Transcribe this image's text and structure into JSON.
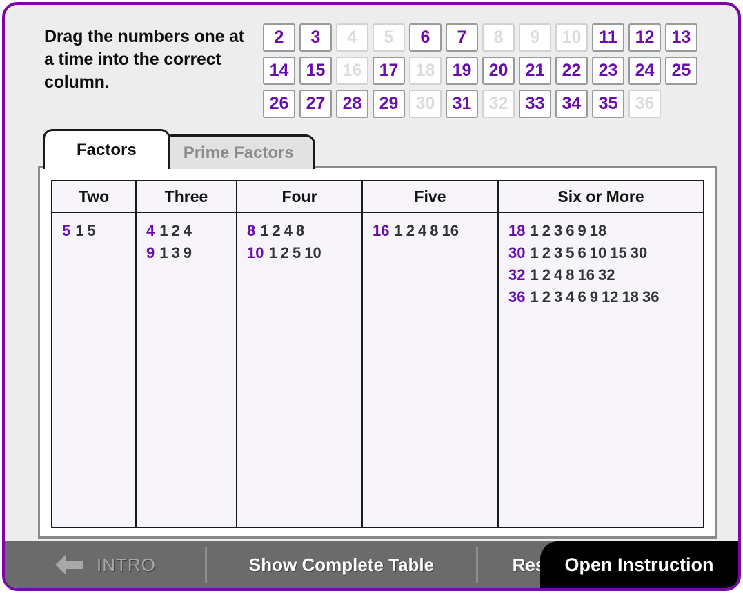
{
  "instruction": "Drag the numbers one at a time into the correct column.",
  "number_tray": {
    "rows": [
      [
        {
          "n": "2",
          "placed": false
        },
        {
          "n": "3",
          "placed": false
        },
        {
          "n": "4",
          "placed": true
        },
        {
          "n": "5",
          "placed": true
        },
        {
          "n": "6",
          "placed": false
        },
        {
          "n": "7",
          "placed": false
        },
        {
          "n": "8",
          "placed": true
        },
        {
          "n": "9",
          "placed": true
        },
        {
          "n": "10",
          "placed": true
        },
        {
          "n": "11",
          "placed": false
        },
        {
          "n": "12",
          "placed": false
        },
        {
          "n": "13",
          "placed": false
        }
      ],
      [
        {
          "n": "14",
          "placed": false
        },
        {
          "n": "15",
          "placed": false
        },
        {
          "n": "16",
          "placed": true
        },
        {
          "n": "17",
          "placed": false
        },
        {
          "n": "18",
          "placed": true
        },
        {
          "n": "19",
          "placed": false
        },
        {
          "n": "20",
          "placed": false
        },
        {
          "n": "21",
          "placed": false
        },
        {
          "n": "22",
          "placed": false
        },
        {
          "n": "23",
          "placed": false
        },
        {
          "n": "24",
          "placed": false
        },
        {
          "n": "25",
          "placed": false
        }
      ],
      [
        {
          "n": "26",
          "placed": false
        },
        {
          "n": "27",
          "placed": false
        },
        {
          "n": "28",
          "placed": false
        },
        {
          "n": "29",
          "placed": false
        },
        {
          "n": "30",
          "placed": true
        },
        {
          "n": "31",
          "placed": false
        },
        {
          "n": "32",
          "placed": true
        },
        {
          "n": "33",
          "placed": false
        },
        {
          "n": "34",
          "placed": false
        },
        {
          "n": "35",
          "placed": false
        },
        {
          "n": "36",
          "placed": true
        }
      ]
    ]
  },
  "tabs": [
    {
      "label": "Factors",
      "active": true
    },
    {
      "label": "Prime Factors",
      "active": false
    }
  ],
  "table": {
    "headers": [
      "Two",
      "Three",
      "Four",
      "Five",
      "Six or More"
    ],
    "columns": [
      {
        "header": "Two",
        "entries": [
          {
            "number": "5",
            "factors": [
              "1",
              "5"
            ]
          }
        ]
      },
      {
        "header": "Three",
        "entries": [
          {
            "number": "4",
            "factors": [
              "1",
              "2",
              "4"
            ]
          },
          {
            "number": "9",
            "factors": [
              "1",
              "3",
              "9"
            ]
          }
        ]
      },
      {
        "header": "Four",
        "entries": [
          {
            "number": "8",
            "factors": [
              "1",
              "2",
              "4",
              "8"
            ]
          },
          {
            "number": "10",
            "factors": [
              "1",
              "2",
              "5",
              "10"
            ]
          }
        ]
      },
      {
        "header": "Five",
        "entries": [
          {
            "number": "16",
            "factors": [
              "1",
              "2",
              "4",
              "8",
              "16"
            ]
          }
        ]
      },
      {
        "header": "Six or More",
        "entries": [
          {
            "number": "18",
            "factors": [
              "1",
              "2",
              "3",
              "6",
              "9",
              "18"
            ]
          },
          {
            "number": "30",
            "factors": [
              "1",
              "2",
              "3",
              "5",
              "6",
              "10",
              "15",
              "30"
            ]
          },
          {
            "number": "32",
            "factors": [
              "1",
              "2",
              "4",
              "8",
              "16",
              "32"
            ]
          },
          {
            "number": "36",
            "factors": [
              "1",
              "2",
              "3",
              "4",
              "6",
              "9",
              "12",
              "18",
              "36"
            ]
          }
        ]
      }
    ]
  },
  "toolbar": {
    "intro_label": "INTRO",
    "back_icon": "back-arrow-icon",
    "show_table_label": "Show Complete Table",
    "reset_label": "Reset",
    "open_instruction_label": "Open Instruction"
  },
  "colors": {
    "frame_purple": "#7a08a8",
    "number_purple": "#6a0dad",
    "toolbar_grey": "#6b6b6b",
    "cell_bg": "#f7f5fa",
    "disabled_grey": "#dcdcdc"
  }
}
